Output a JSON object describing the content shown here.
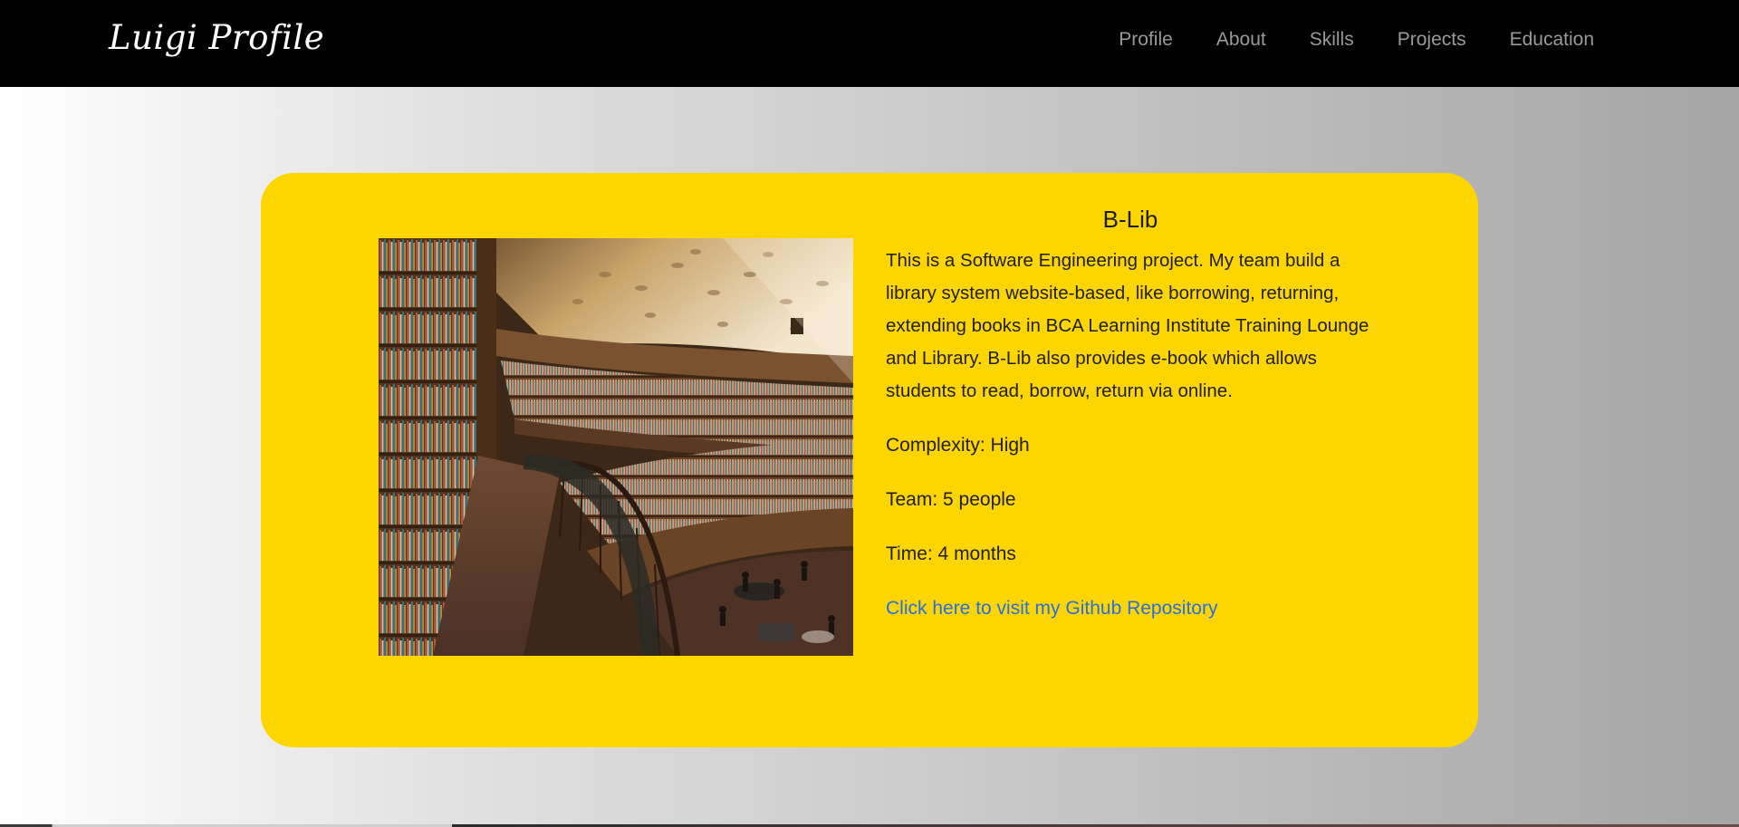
{
  "navbar": {
    "brand": "Luigi Profile",
    "links": [
      {
        "label": "Profile"
      },
      {
        "label": "About"
      },
      {
        "label": "Skills"
      },
      {
        "label": "Projects"
      },
      {
        "label": "Education"
      }
    ]
  },
  "project": {
    "title": "B-Lib",
    "description": "This is a Software Engineering project. My team build a library system website-based, like borrowing, returning, extending books in BCA Learning Institute Training Lounge and Library. B-Lib also provides e-book which allows students to read, borrow, return via online.",
    "complexity": "Complexity: High",
    "team": "Team: 5 people",
    "time": "Time: 4 months",
    "repo_link": "Click here to visit my Github Repository"
  },
  "colors": {
    "navbar_bg": "#000000",
    "card_bg": "#fdd602",
    "link": "#2a6fde",
    "nav_text": "#9a9a9a"
  }
}
